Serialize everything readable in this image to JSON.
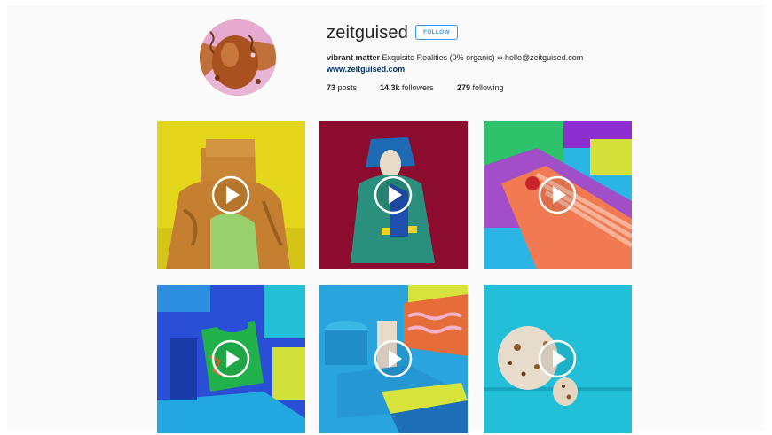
{
  "profile": {
    "username": "zeitguised",
    "follow_label": "FOLLOW",
    "bio_name": "vibrant matter",
    "bio_text": "Exquisite Realities (0% organic) ∞ hello@zeitguised.com",
    "website": "www.zeitguised.com",
    "stats": {
      "posts_count": "73",
      "posts_label": "posts",
      "followers_count": "14.3k",
      "followers_label": "followers",
      "following_count": "279",
      "following_label": "following"
    }
  },
  "colors": {
    "accent": "#3897f0",
    "link": "#003569",
    "background": "#fafafa"
  },
  "posts": [
    {
      "type": "video",
      "icon": "play-icon",
      "palette": [
        "#e7d81c",
        "#c8862f",
        "#9bd46f"
      ]
    },
    {
      "type": "video",
      "icon": "play-icon",
      "palette": [
        "#8e0d2f",
        "#2a8a7c",
        "#1f5fb0"
      ]
    },
    {
      "type": "video",
      "icon": "play-icon",
      "palette": [
        "#35b9e6",
        "#f07a4f",
        "#a04fc8"
      ]
    },
    {
      "type": "video",
      "icon": "play-icon",
      "palette": [
        "#2d4fd6",
        "#22c0d8",
        "#22b24c"
      ]
    },
    {
      "type": "video",
      "icon": "play-icon",
      "palette": [
        "#2aa8dc",
        "#d9e23a",
        "#e86a3a"
      ]
    },
    {
      "type": "video",
      "icon": "play-icon",
      "palette": [
        "#21c1d8",
        "#e8dccb",
        "#8a5a2a"
      ]
    }
  ]
}
